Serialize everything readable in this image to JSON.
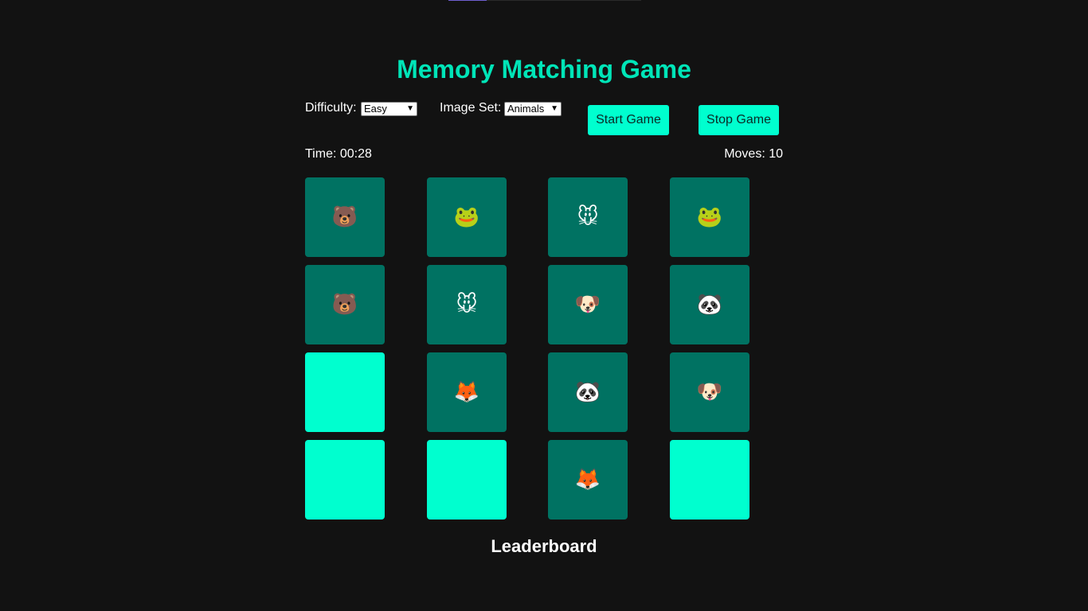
{
  "title": "Memory Matching Game",
  "controls": {
    "difficulty_label": "Difficulty:",
    "difficulty_value": "Easy",
    "image_set_label": "Image Set:",
    "image_set_value": "Animals",
    "start_label": "Start Game",
    "stop_label": "Stop Game"
  },
  "stats": {
    "time": "Time: 00:28",
    "moves": "Moves: 10"
  },
  "board": {
    "cards": [
      {
        "state": "face-up",
        "icon": "bear-icon",
        "glyph": "🐻"
      },
      {
        "state": "face-up",
        "icon": "frog-icon",
        "glyph": "🐸"
      },
      {
        "state": "face-up",
        "icon": "mouse-icon",
        "glyph": "🐭"
      },
      {
        "state": "face-up",
        "icon": "frog-icon",
        "glyph": "🐸"
      },
      {
        "state": "face-up",
        "icon": "bear-icon",
        "glyph": "🐻"
      },
      {
        "state": "face-up",
        "icon": "mouse-icon",
        "glyph": "🐭"
      },
      {
        "state": "face-up",
        "icon": "dog-icon",
        "glyph": "🐶"
      },
      {
        "state": "face-up",
        "icon": "panda-icon",
        "glyph": "🐼"
      },
      {
        "state": "face-down",
        "icon": "",
        "glyph": ""
      },
      {
        "state": "face-up",
        "icon": "fox-icon",
        "glyph": "🦊"
      },
      {
        "state": "face-up",
        "icon": "panda-icon",
        "glyph": "🐼"
      },
      {
        "state": "face-up",
        "icon": "dog-icon",
        "glyph": "🐶"
      },
      {
        "state": "face-down",
        "icon": "",
        "glyph": ""
      },
      {
        "state": "face-down",
        "icon": "",
        "glyph": ""
      },
      {
        "state": "face-up",
        "icon": "fox-icon",
        "glyph": "🦊"
      },
      {
        "state": "face-down",
        "icon": "",
        "glyph": ""
      }
    ]
  },
  "leaderboard": {
    "heading": "Leaderboard"
  },
  "colors": {
    "accent": "#00e5b8",
    "card_face_down": "#00ffcf",
    "card_face_up": "#007262",
    "background": "#121212"
  }
}
